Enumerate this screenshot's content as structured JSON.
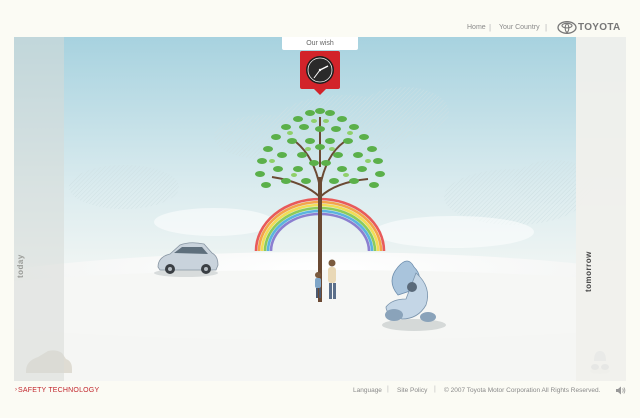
{
  "header": {
    "nav": [
      {
        "label": "Home"
      },
      {
        "label": "Your Country"
      }
    ],
    "brand": "TOYOTA"
  },
  "stage": {
    "tab_label": "Our wish",
    "left_panel_label": "today",
    "right_panel_label": "tomorrow"
  },
  "footer": {
    "section_link": "SAFETY TECHNOLOGY",
    "links": [
      {
        "label": "Language"
      },
      {
        "label": "Site Policy"
      }
    ],
    "copyright": "© 2007 Toyota Motor Corporation All Rights Reserved."
  },
  "colors": {
    "accent_red": "#c2272d",
    "sky_top": "#a9d3e0",
    "ground": "#f6f6f4",
    "leaf_green": "#5bb04a"
  },
  "icons": [
    "toyota-logo-icon",
    "clock-icon",
    "sound-icon",
    "car-icon",
    "robot-vehicle-icon",
    "tree-icon",
    "rainbow-icon"
  ]
}
